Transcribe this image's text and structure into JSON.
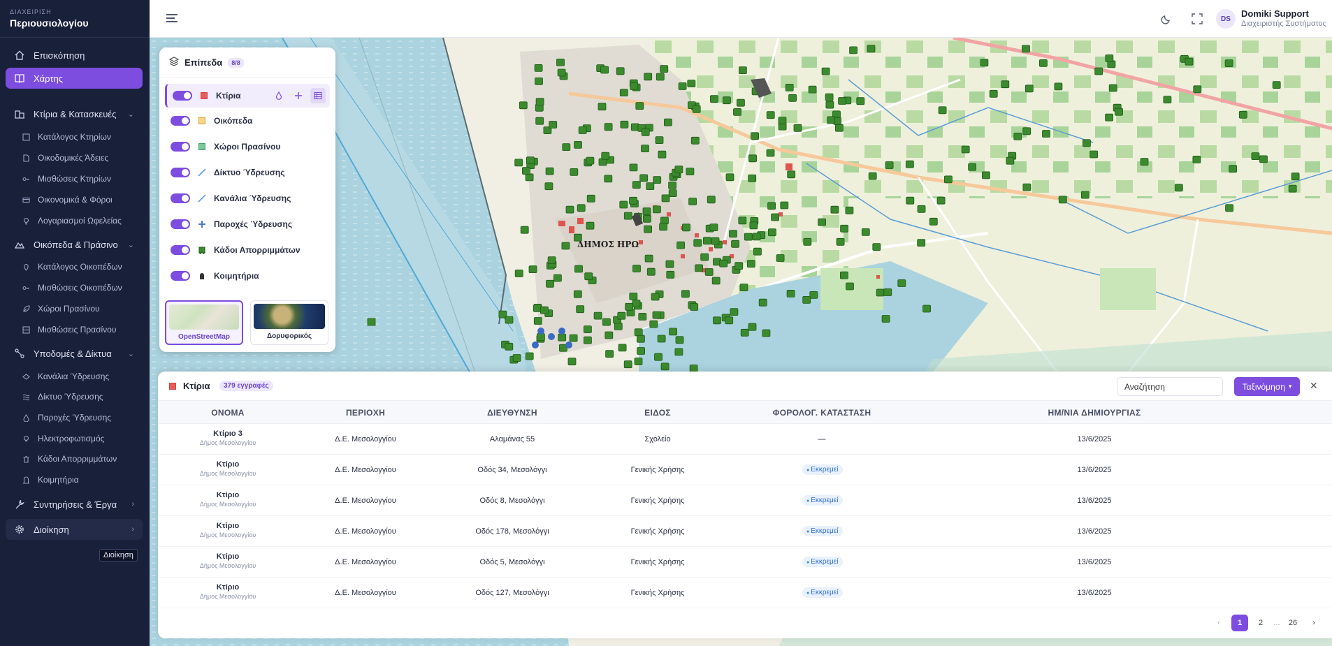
{
  "brand": {
    "small": "ΔΙΑΧΕΙΡΙΣΗ",
    "big": "Περιουσιολογίου"
  },
  "sidebar": {
    "overview": "Επισκόπηση",
    "map": "Χάρτης",
    "buildings_section": "Κτίρια & Κατασκευές",
    "buildings_items": [
      "Κατάλογος Κτηρίων",
      "Οικοδομικές Άδειες",
      "Μισθώσεις Κτηρίων",
      "Οικονομικά & Φόροι",
      "Λογαριασμοί Ωφελείας"
    ],
    "plots_section": "Οικόπεδα & Πράσινο",
    "plots_items": [
      "Κατάλογος Οικοπέδων",
      "Μισθώσεις Οικοπέδων",
      "Χώροι Πρασίνου",
      "Μισθώσεις Πρασίνου"
    ],
    "infra_section": "Υποδομές & Δίκτυα",
    "infra_items": [
      "Κανάλια Ύδρευσης",
      "Δίκτυο Ύδρευσης",
      "Παροχές Ύδρευσης",
      "Ηλεκτροφωτισμός",
      "Κάδοι Απορριμμάτων",
      "Κοιμητήρια"
    ],
    "maintenance": "Συντηρήσεις & Έργα",
    "admin": "Διοίκηση",
    "tooltip": "Διοίκηση"
  },
  "header": {
    "avatar": "DS",
    "user_name": "Domiki Support",
    "user_role": "Διαχειριστής Συστήματος"
  },
  "map_label": "ΔΗΜΟΣ ΗΡΩ",
  "layers": {
    "title": "Επίπεδα",
    "count": "8/8",
    "items": [
      {
        "label": "Κτίρια",
        "color": "#e85c5c"
      },
      {
        "label": "Οικόπεδα",
        "color": "#f2b84b"
      },
      {
        "label": "Χώροι Πρασίνου",
        "color": "#3fa56a"
      },
      {
        "label": "Δίκτυο Ύδρευσης",
        "color": "#4a90e2"
      },
      {
        "label": "Κανάλια Ύδρευσης",
        "color": "#4a90e2"
      },
      {
        "label": "Παροχές Ύδρευσης",
        "color": "#4a7bd0"
      },
      {
        "label": "Κάδοι Απορριμμάτων",
        "color": "#2e7d32"
      },
      {
        "label": "Κοιμητήρια",
        "color": "#333333"
      }
    ],
    "basemaps": [
      "OpenStreetMap",
      "Δορυφορικός"
    ]
  },
  "table": {
    "title": "Κτίρια",
    "count_label": "379 εγγραφές",
    "search_value": "Αναζήτηση",
    "sort_label": "Ταξινόμηση",
    "columns": [
      "ΟΝΟΜΑ",
      "ΠΕΡΙΟΧΗ",
      "ΔΙΕΥΘΥΝΣΗ",
      "ΕΙΔΟΣ",
      "ΦΟΡΟΛΟΓ. ΚΑΤΑΣΤΑΣΗ",
      "ΗΜ/ΝΙΑ ΔΗΜΙΟΥΡΓΙΑΣ"
    ],
    "rows": [
      {
        "name": "Κτίριο 3",
        "sub": "Δήμος Μεσολογγίου",
        "area": "Δ.Ε. Μεσολογγίου",
        "address": "Αλαμάνας 55",
        "kind": "Σχολείο",
        "status": "—",
        "date": "13/6/2025"
      },
      {
        "name": "Κτίριο",
        "sub": "Δήμος Μεσολογγίου",
        "area": "Δ.Ε. Μεσολογγίου",
        "address": "Οδός 34, Μεσολόγγι",
        "kind": "Γενικής Χρήσης",
        "status": "Εκκρεμεί",
        "date": "13/6/2025"
      },
      {
        "name": "Κτίριο",
        "sub": "Δήμος Μεσολογγίου",
        "area": "Δ.Ε. Μεσολογγίου",
        "address": "Οδός 8, Μεσολόγγι",
        "kind": "Γενικής Χρήσης",
        "status": "Εκκρεμεί",
        "date": "13/6/2025"
      },
      {
        "name": "Κτίριο",
        "sub": "Δήμος Μεσολογγίου",
        "area": "Δ.Ε. Μεσολογγίου",
        "address": "Οδός 178, Μεσολόγγι",
        "kind": "Γενικής Χρήσης",
        "status": "Εκκρεμεί",
        "date": "13/6/2025"
      },
      {
        "name": "Κτίριο",
        "sub": "Δήμος Μεσολογγίου",
        "area": "Δ.Ε. Μεσολογγίου",
        "address": "Οδός 5, Μεσολόγγι",
        "kind": "Γενικής Χρήσης",
        "status": "Εκκρεμεί",
        "date": "13/6/2025"
      },
      {
        "name": "Κτίριο",
        "sub": "Δήμος Μεσολογγίου",
        "area": "Δ.Ε. Μεσολογγίου",
        "address": "Οδός 127, Μεσολόγγι",
        "kind": "Γενικής Χρήσης",
        "status": "Εκκρεμεί",
        "date": "13/6/2025"
      }
    ],
    "pager": {
      "prev": "‹",
      "pages": [
        "1",
        "2",
        "...",
        "26"
      ],
      "next": "›"
    }
  },
  "colors": {
    "accent": "#7c4dde",
    "sidebar_bg": "#19203a",
    "status_blue": "#2f6fd0"
  }
}
